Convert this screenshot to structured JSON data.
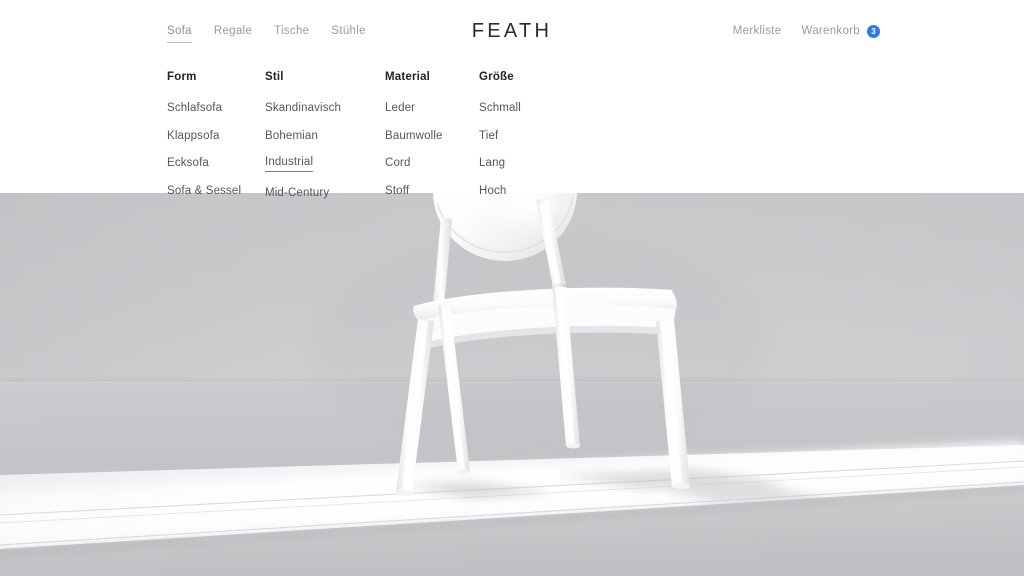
{
  "header": {
    "logo": "FEATH",
    "nav_left": [
      {
        "label": "Sofa",
        "active": true
      },
      {
        "label": "Regale",
        "active": false
      },
      {
        "label": "Tische",
        "active": false
      },
      {
        "label": "Stühle",
        "active": false
      }
    ],
    "nav_right": {
      "wishlist_label": "Merkliste",
      "cart_label": "Warenkorb",
      "cart_count": "3",
      "badge_color": "#2b7de3"
    }
  },
  "megamenu": {
    "columns": [
      {
        "title": "Form",
        "items": [
          {
            "label": "Schlafsofa",
            "underlined": false
          },
          {
            "label": "Klappsofa",
            "underlined": false
          },
          {
            "label": "Ecksofa",
            "underlined": false
          },
          {
            "label": "Sofa & Sessel",
            "underlined": false
          }
        ]
      },
      {
        "title": "Stil",
        "items": [
          {
            "label": "Skandinavisch",
            "underlined": false
          },
          {
            "label": "Bohemian",
            "underlined": false
          },
          {
            "label": "Industrial",
            "underlined": true
          },
          {
            "label": "Mid-Century",
            "underlined": false
          }
        ]
      },
      {
        "title": "Material",
        "items": [
          {
            "label": "Leder",
            "underlined": false
          },
          {
            "label": "Baumwolle",
            "underlined": false
          },
          {
            "label": "Cord",
            "underlined": false
          },
          {
            "label": "Stoff",
            "underlined": false
          }
        ]
      },
      {
        "title": "Größe",
        "items": [
          {
            "label": "Schmall",
            "underlined": false
          },
          {
            "label": "Tief",
            "underlined": false
          },
          {
            "label": "Lang",
            "underlined": false
          },
          {
            "label": "Hoch",
            "underlined": false
          }
        ]
      }
    ]
  },
  "hero": {
    "subject": "white-chair-photo",
    "wall_color": "#c8c9cb",
    "floor_color": "#f4f5f6",
    "chair_color": "#ffffff"
  }
}
